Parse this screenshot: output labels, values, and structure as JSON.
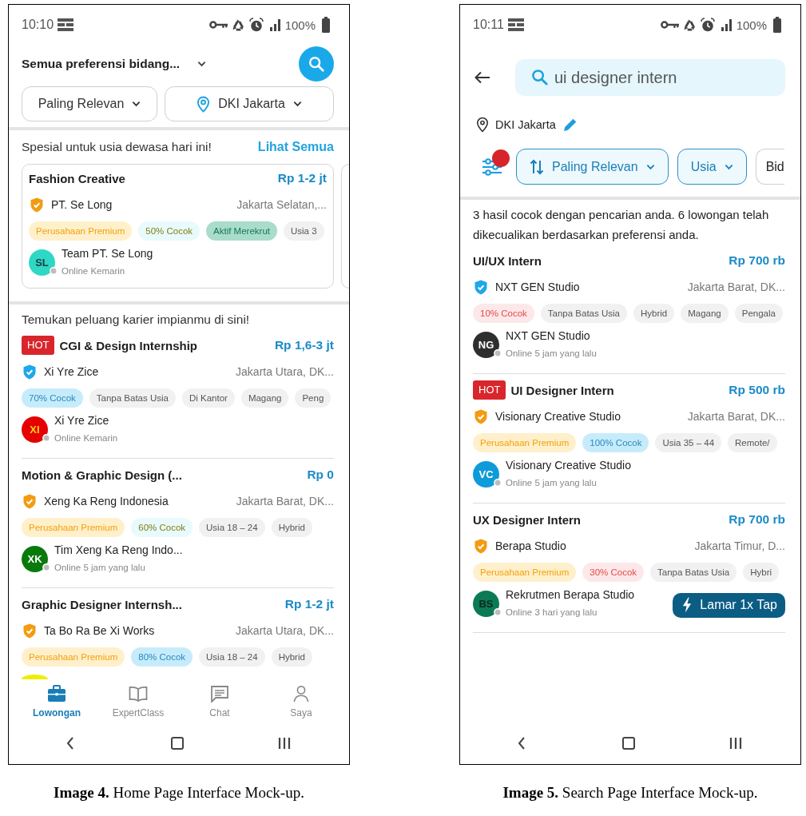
{
  "figures": [
    {
      "kind": "home",
      "status_bar": {
        "time": "10:10",
        "battery": "100%"
      },
      "header": {
        "title": "Semua preferensi bidang..."
      },
      "filters": [
        {
          "label": "Paling Relevan",
          "kind": "dropdown"
        },
        {
          "label": "DKI Jakarta",
          "kind": "location"
        }
      ],
      "featured": {
        "title": "Spesial untuk usia dewasa hari ini!",
        "link": "Lihat Semua",
        "cards": [
          {
            "title": "Fashion Creative",
            "salary": "Rp 1-2 jt",
            "company": {
              "name": "PT. Se Long",
              "kind": "premium"
            },
            "location": "Jakarta Selatan,...",
            "tags": [
              {
                "label": "Perusahaan Premium",
                "kind": "premium"
              },
              {
                "label": "50% Cocok",
                "kind": "match-mid"
              },
              {
                "label": "Aktif Merekrut",
                "kind": "hiring"
              },
              {
                "label": "Usia 3",
                "kind": "plain"
              }
            ],
            "recruiter": {
              "initials": {
                "text": "SL",
                "color": "#1d3a48"
              },
              "name": "Team PT. Se Long",
              "status": "Online Kemarin",
              "color": "#2fd8c4"
            }
          }
        ]
      },
      "section_title": "Temukan peluang karier impianmu di sini!",
      "jobs": [
        {
          "hot": "HOT",
          "title": "CGI & Design Internship",
          "salary": "Rp 1,6-3 jt",
          "company": {
            "name": "Xi Yre Zice",
            "kind": "verified"
          },
          "location": "Jakarta Utara, DK...",
          "tags": [
            {
              "label": "70% Cocok",
              "kind": "match-high"
            },
            {
              "label": "Tanpa Batas Usia",
              "kind": "plain"
            },
            {
              "label": "Di Kantor",
              "kind": "plain"
            },
            {
              "label": "Magang",
              "kind": "plain"
            },
            {
              "label": "Peng",
              "kind": "plain"
            }
          ],
          "recruiter": {
            "initials": {
              "text": "XI",
              "color": "#ffd21a"
            },
            "name": "Xi Yre Zice",
            "status": "Online Kemarin",
            "color": "#e60000"
          }
        },
        {
          "title": "Motion & Graphic Design (...",
          "salary": "Rp 0",
          "company": {
            "name": "Xeng Ka Reng Indonesia",
            "kind": "premium"
          },
          "location": "Jakarta Barat, DK...",
          "tags": [
            {
              "label": "Perusahaan Premium",
              "kind": "premium"
            },
            {
              "label": "60% Cocok",
              "kind": "match-mid"
            },
            {
              "label": "Usia 18 – 24",
              "kind": "plain"
            },
            {
              "label": "Hybrid",
              "kind": "plain"
            }
          ],
          "recruiter": {
            "initials": {
              "text": "XK",
              "color": "#ffffff"
            },
            "name": "Tim Xeng Ka Reng Indo...",
            "status": "Online 5 jam yang lalu",
            "color": "#087a0c"
          }
        },
        {
          "title": "Graphic Designer Internsh...",
          "salary": "Rp 1-2 jt",
          "company": {
            "name": "Ta Bo Ra Be Xi Works",
            "kind": "premium"
          },
          "location": "Jakarta Utara, DK...",
          "tags": [
            {
              "label": "Perusahaan Premium",
              "kind": "premium"
            },
            {
              "label": "80% Cocok",
              "kind": "match-high"
            },
            {
              "label": "Usia 18 – 24",
              "kind": "plain"
            },
            {
              "label": "Hybrid",
              "kind": "plain"
            }
          ],
          "recruiter": {
            "color": "#eeee00"
          }
        }
      ],
      "bottom_nav": [
        {
          "label": "Lowongan",
          "selected": true
        },
        {
          "label": "ExpertClass",
          "selected": false
        },
        {
          "label": "Chat",
          "selected": false
        },
        {
          "label": "Saya",
          "selected": false
        }
      ],
      "caption": "**Image 4.** Home Page Interface Mock-up."
    },
    {
      "kind": "search",
      "status_bar": {
        "time": "10:11",
        "battery": "100%"
      },
      "search": {
        "value": "ui designer intern"
      },
      "location": "DKI Jakarta",
      "filter_badge": true,
      "chips": [
        {
          "label": "Paling Relevan",
          "kind": "sort",
          "selected": true
        },
        {
          "label": "Usia",
          "kind": "dropdown",
          "selected": true
        },
        {
          "label": "Bid",
          "kind": "plain",
          "selected": false
        }
      ],
      "summary": "3 hasil cocok dengan pencarian anda. 6 lowongan telah dikecualikan berdasarkan preferensi anda.",
      "jobs": [
        {
          "title": "UI/UX Intern",
          "salary": "Rp 700 rb",
          "company": {
            "name": "NXT GEN Studio",
            "kind": "verified"
          },
          "location": "Jakarta Barat, DK...",
          "tags": [
            {
              "label": "10% Cocok",
              "kind": "match-low"
            },
            {
              "label": "Tanpa Batas Usia",
              "kind": "plain"
            },
            {
              "label": "Hybrid",
              "kind": "plain"
            },
            {
              "label": "Magang",
              "kind": "plain"
            },
            {
              "label": "Pengala",
              "kind": "plain"
            }
          ],
          "recruiter": {
            "initials": {
              "text": "NG",
              "color": "#ffffff"
            },
            "name": "NXT GEN Studio",
            "status": "Online 5 jam yang lalu",
            "color": "#2e2e2e"
          }
        },
        {
          "hot": "HOT",
          "title": "UI Designer Intern",
          "salary": "Rp 500 rb",
          "company": {
            "name": "Visionary Creative Studio",
            "kind": "premium"
          },
          "location": "Jakarta Barat, DK...",
          "tags": [
            {
              "label": "Perusahaan Premium",
              "kind": "premium"
            },
            {
              "label": "100% Cocok",
              "kind": "match-high"
            },
            {
              "label": "Usia 35 – 44",
              "kind": "plain"
            },
            {
              "label": "Remote/",
              "kind": "plain"
            }
          ],
          "recruiter": {
            "initials": {
              "text": "VC",
              "color": "#ffffff"
            },
            "name": "Visionary Creative Studio",
            "status": "Online 5 jam yang lalu",
            "color": "#0e9bd9"
          }
        },
        {
          "title": "UX Designer Intern",
          "salary": "Rp 700 rb",
          "company": {
            "name": "Berapa Studio",
            "kind": "premium"
          },
          "location": "Jakarta Timur, D...",
          "tags": [
            {
              "label": "Perusahaan Premium",
              "kind": "premium"
            },
            {
              "label": "30% Cocok",
              "kind": "match-low"
            },
            {
              "label": "Tanpa Batas Usia",
              "kind": "plain"
            },
            {
              "label": "Hybri",
              "kind": "plain"
            }
          ],
          "recruiter": {
            "initials": {
              "text": "BS",
              "color": "#0b2a20"
            },
            "name": "Rekrutmen Berapa Studio",
            "status": "Online 3 hari yang lalu",
            "color": "#0b7a55"
          },
          "apply_button": "Lamar 1x Tap"
        }
      ],
      "caption": "**Image 5.** Search Page Interface Mock-up."
    }
  ]
}
